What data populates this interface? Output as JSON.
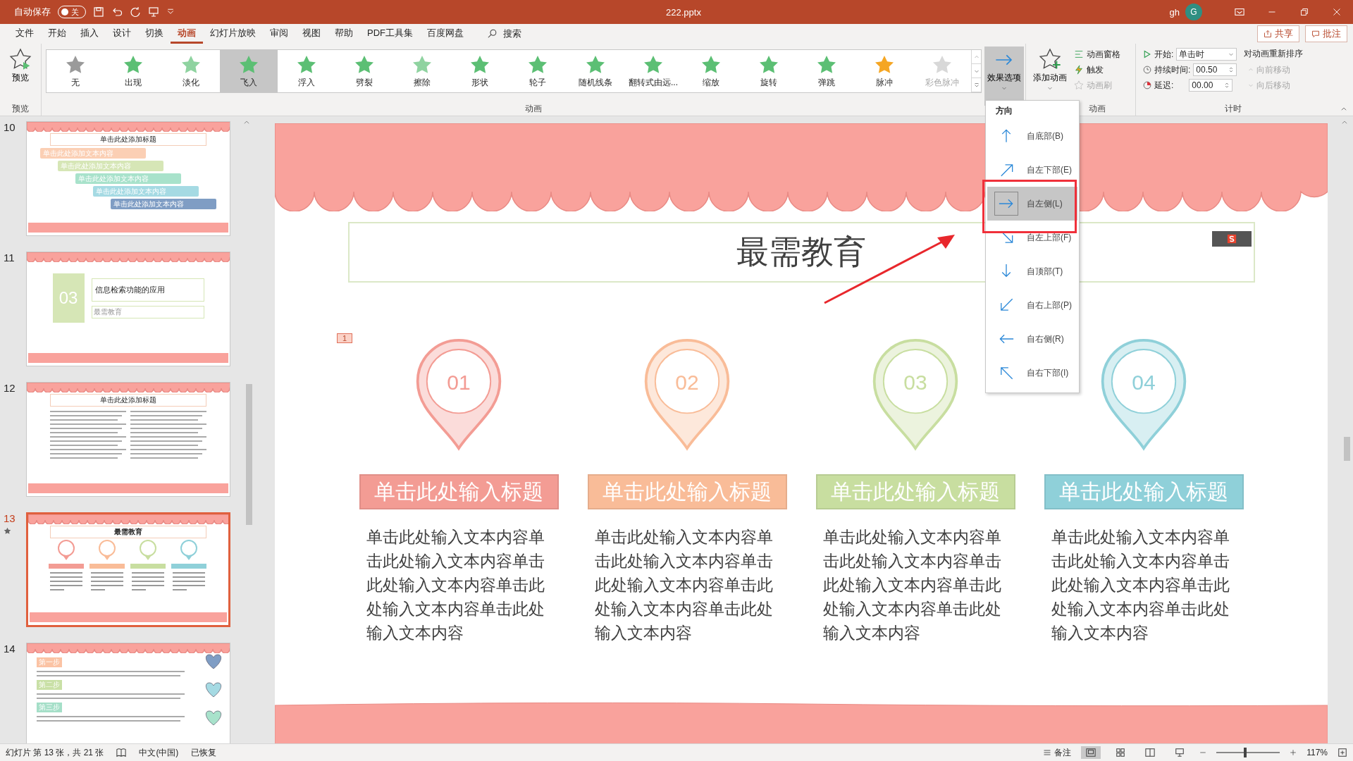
{
  "title_bar": {
    "autosave_label": "自动保存",
    "autosave_on": false,
    "autosave_state": "关",
    "filename": "222.pptx",
    "user": "gh",
    "avatar": "G"
  },
  "menu_tabs": [
    {
      "label": "文件",
      "selected": false
    },
    {
      "label": "开始",
      "selected": false
    },
    {
      "label": "插入",
      "selected": false
    },
    {
      "label": "设计",
      "selected": false
    },
    {
      "label": "切换",
      "selected": false
    },
    {
      "label": "动画",
      "selected": true
    },
    {
      "label": "幻灯片放映",
      "selected": false
    },
    {
      "label": "审阅",
      "selected": false
    },
    {
      "label": "视图",
      "selected": false
    },
    {
      "label": "帮助",
      "selected": false
    },
    {
      "label": "PDF工具集",
      "selected": false
    },
    {
      "label": "百度网盘",
      "selected": false
    }
  ],
  "search": "搜索",
  "share": "共享",
  "comments": "批注",
  "ribbon": {
    "preview": {
      "label": "预览",
      "group": "预览"
    },
    "animations": [
      {
        "label": "无",
        "selected": false,
        "disabled": false,
        "color": "#9a9a9a"
      },
      {
        "label": "出现",
        "selected": false,
        "disabled": false,
        "color": "#5cbf74"
      },
      {
        "label": "淡化",
        "selected": false,
        "disabled": false,
        "color": "#8fd3a0"
      },
      {
        "label": "飞入",
        "selected": true,
        "disabled": false,
        "color": "#5cbf74"
      },
      {
        "label": "浮入",
        "selected": false,
        "disabled": false,
        "color": "#5cbf74"
      },
      {
        "label": "劈裂",
        "selected": false,
        "disabled": false,
        "color": "#5cbf74"
      },
      {
        "label": "擦除",
        "selected": false,
        "disabled": false,
        "color": "#8fd3a0"
      },
      {
        "label": "形状",
        "selected": false,
        "disabled": false,
        "color": "#5cbf74"
      },
      {
        "label": "轮子",
        "selected": false,
        "disabled": false,
        "color": "#5cbf74"
      },
      {
        "label": "随机线条",
        "selected": false,
        "disabled": false,
        "color": "#5cbf74"
      },
      {
        "label": "翻转式由远...",
        "selected": false,
        "disabled": false,
        "color": "#5cbf74"
      },
      {
        "label": "缩放",
        "selected": false,
        "disabled": false,
        "color": "#5cbf74"
      },
      {
        "label": "旋转",
        "selected": false,
        "disabled": false,
        "color": "#5cbf74"
      },
      {
        "label": "弹跳",
        "selected": false,
        "disabled": false,
        "color": "#5cbf74"
      },
      {
        "label": "脉冲",
        "selected": false,
        "disabled": false,
        "color": "#f5a623"
      },
      {
        "label": "彩色脉冲",
        "selected": false,
        "disabled": true,
        "color": "#d8d8d8"
      }
    ],
    "animations_group": "动画",
    "effect_options": "效果选项",
    "add_animation": "添加动画",
    "advanced_items": [
      {
        "label": "动画窗格",
        "disabled": false
      },
      {
        "label": "触发",
        "disabled": false
      },
      {
        "label": "动画刷",
        "disabled": true
      }
    ],
    "advanced_group": "动画",
    "timing": {
      "start_label": "开始:",
      "start_value": "单击时",
      "duration_label": "持续时间:",
      "duration": "00.50",
      "delay_label": "延迟:",
      "delay": "00.00",
      "reorder": "对动画重新排序",
      "move_earlier": "向前移动",
      "move_later": "向后移动",
      "moves_disabled": true,
      "group": "计时"
    }
  },
  "direction_menu": {
    "heading": "方向",
    "items": [
      {
        "label": "自底部(B)",
        "kind": "north",
        "selected": false
      },
      {
        "label": "自左下部(E)",
        "kind": "northeast",
        "selected": false
      },
      {
        "label": "自左侧(L)",
        "kind": "east",
        "selected": true
      },
      {
        "label": "自左上部(F)",
        "kind": "southeast",
        "selected": false
      },
      {
        "label": "自顶部(T)",
        "kind": "south",
        "selected": false
      },
      {
        "label": "自右上部(P)",
        "kind": "southwest",
        "selected": false
      },
      {
        "label": "自右侧(R)",
        "kind": "west",
        "selected": false
      },
      {
        "label": "自右下部(I)",
        "kind": "northwest",
        "selected": false
      }
    ]
  },
  "thumbnails": [
    {
      "number": "10",
      "selected": false,
      "animated": false,
      "kind": "steps",
      "title": "单击此处添加标题",
      "items": [
        {
          "text": "单击此处添加文本内容",
          "color": "#fbcfb4"
        },
        {
          "text": "单击此处添加文本内容",
          "color": "#d6e6b6"
        },
        {
          "text": "单击此处添加文本内容",
          "color": "#a8e2cb"
        },
        {
          "text": "单击此处添加文本内容",
          "color": "#a5dae3"
        },
        {
          "text": "单击此处添加文本内容",
          "color": "#7f9dc4"
        }
      ]
    },
    {
      "number": "11",
      "selected": false,
      "animated": false,
      "kind": "section",
      "badge": "03",
      "title": "信息检索功能的应用",
      "subtitle": "最需教育"
    },
    {
      "number": "12",
      "selected": false,
      "animated": false,
      "kind": "columns",
      "title": "单击此处添加标题"
    },
    {
      "number": "13",
      "selected": true,
      "animated": true,
      "kind": "pins",
      "title": "最需教育"
    },
    {
      "number": "14",
      "selected": false,
      "animated": false,
      "kind": "hearts",
      "labels": [
        "第一步",
        "第二步",
        "第三步"
      ]
    }
  ],
  "slide": {
    "title": "最需教育",
    "animation_tag": "1",
    "cards": [
      {
        "number": "01",
        "heading": "单击此处输入标题",
        "body": "单击此处输入文本内容单击此处输入文本内容单击此处输入文本内容单击此处输入文本内容单击此处输入文本内容",
        "color": "#f39c94"
      },
      {
        "number": "02",
        "heading": "单击此处输入标题",
        "body": "单击此处输入文本内容单击此处输入文本内容单击此处输入文本内容单击此处输入文本内容单击此处输入文本内容",
        "color": "#f9bc98"
      },
      {
        "number": "03",
        "heading": "单击此处输入标题",
        "body": "单击此处输入文本内容单击此处输入文本内容单击此处输入文本内容单击此处输入文本内容单击此处输入文本内容",
        "color": "#c8dea0"
      },
      {
        "number": "04",
        "heading": "单击此处输入标题",
        "body": "单击此处输入文本内容单击此处输入文本内容单击此处输入文本内容单击此处输入文本内容单击此处输入文本内容",
        "color": "#8fd0d9"
      }
    ]
  },
  "status_bar": {
    "slide_info": "幻灯片 第 13 张，共 21 张",
    "language": "中文(中国)",
    "recovered": "已恢复",
    "notes": "备注",
    "zoom": "117%",
    "zoom_slider": {
      "level": 0.45
    }
  }
}
